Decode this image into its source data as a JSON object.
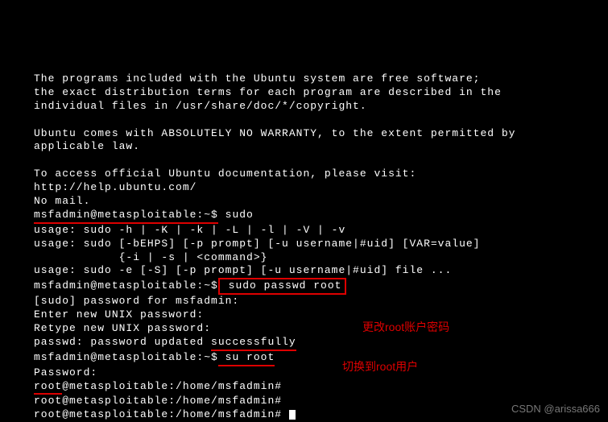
{
  "terminal": {
    "intro1": "The programs included with the Ubuntu system are free software;",
    "intro2": "the exact distribution terms for each program are described in the",
    "intro3": "individual files in /usr/share/doc/*/copyright.",
    "warranty1": "Ubuntu comes with ABSOLUTELY NO WARRANTY, to the extent permitted by",
    "warranty2": "applicable law.",
    "docs1": "To access official Ubuntu documentation, please visit:",
    "docs_url": "http://help.ubuntu.com/",
    "nomail": "No mail.",
    "prompt1_user": "msfadmin@metasploitable:~$",
    "prompt1_cmd": " sudo",
    "usage1": "usage: sudo -h | -K | -k | -L | -l | -V | -v",
    "usage2": "usage: sudo [-bEHPS] [-p prompt] [-u username|#uid] [VAR=value]",
    "usage2b": "            {-i | -s | <command>}",
    "usage3": "usage: sudo -e [-S] [-p prompt] [-u username|#uid] file ...",
    "prompt2_user": "msfadmin@metasploitable:~$",
    "prompt2_cmd": " sudo passwd root",
    "sudo_pw": "[sudo] password for msfadmin:",
    "enter_pw": "Enter new UNIX password:",
    "retype_pw": "Retype new UNIX password:",
    "passwd_ok1": "passwd: password updated ",
    "passwd_ok2": "successfully",
    "prompt3_user": "msfadmin@metasploitable:~$",
    "prompt3_cmd": " su root",
    "pw_prompt": "Password:",
    "root1_prefix": "root",
    "root1_rest": "@metasploitable:/home/msfadmin#",
    "root2": "root@metasploitable:/home/msfadmin#",
    "root3": "root@metasploitable:/home/msfadmin# "
  },
  "annotations": {
    "change_pw": "更改root账户密码",
    "switch_user": "切换到root用户"
  },
  "watermark": "CSDN @arissa666"
}
